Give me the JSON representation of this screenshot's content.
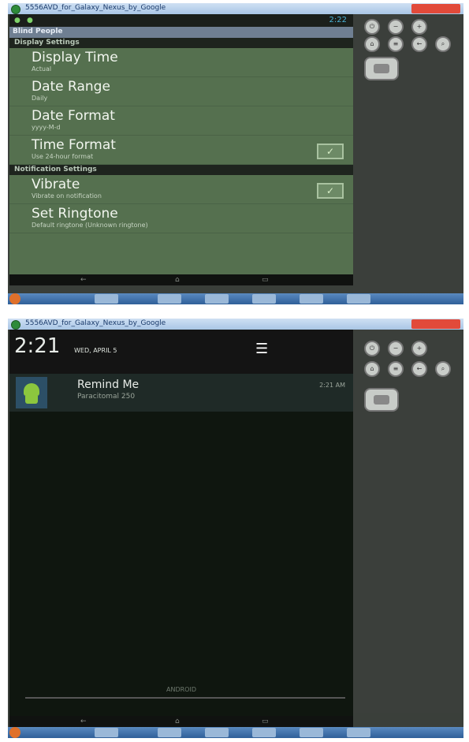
{
  "shot1": {
    "window_title": "5556AVD_for_Galaxy_Nexus_by_Google",
    "status_clock": "2:22",
    "app_title": "Blind People",
    "categories": {
      "display": "Display Settings",
      "notification": "Notification Settings"
    },
    "preferences": [
      {
        "title": "Display Time",
        "summary": "Actual",
        "has_check": false
      },
      {
        "title": "Date Range",
        "summary": "Daily",
        "has_check": false
      },
      {
        "title": "Date Format",
        "summary": "yyyy-M-d",
        "has_check": false
      },
      {
        "title": "Time Format",
        "summary": "Use 24-hour format",
        "has_check": true,
        "checked": true
      },
      {
        "title": "Vibrate",
        "summary": "Vibrate on notification",
        "has_check": true,
        "checked": true
      },
      {
        "title": "Set Ringtone",
        "summary": "Default ringtone (Unknown ringtone)",
        "has_check": false
      }
    ]
  },
  "shot2": {
    "window_title": "5556AVD_for_Galaxy_Nexus_by_Google",
    "clock": "2:21",
    "date": "WED, APRIL 5",
    "notification": {
      "title": "Remind Me",
      "text": "Paracitomal 250",
      "time": "2:21 AM"
    },
    "carrier": "ANDROID"
  },
  "icons": {
    "check": "check-icon",
    "settings": "quick-settings-icon",
    "app": "android-app-icon"
  },
  "colors": {
    "settings_bg": "#55704f",
    "app_bar": "#6f7f92",
    "notification_bg": "#1f2a27",
    "accent_clock": "#4ab2d6"
  }
}
